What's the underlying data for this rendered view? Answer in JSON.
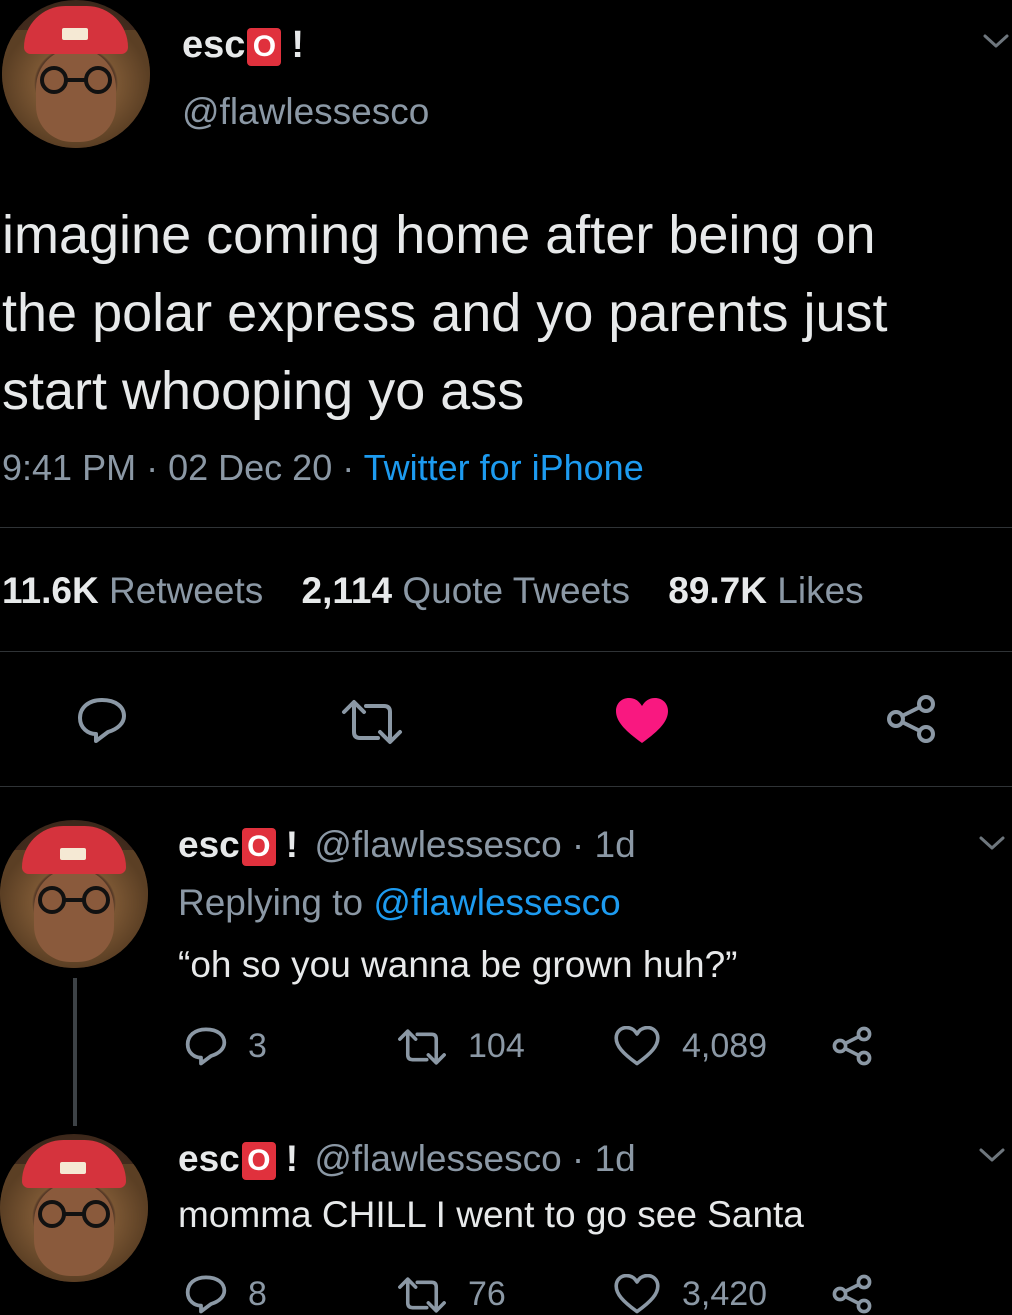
{
  "main_tweet": {
    "display_name_prefix": "esc",
    "display_name_badge": "O",
    "display_name_suffix": "!",
    "handle": "@flawlessesco",
    "text_line1": "imagine coming home after being on",
    "text_line2": "the polar express and yo parents just",
    "text_line3": "start whooping yo ass",
    "time": "9:41 PM",
    "date": "02 Dec 20",
    "source": "Twitter for iPhone",
    "sep": "·",
    "stats": {
      "retweets_num": "11.6K",
      "retweets_label": "Retweets",
      "quotes_num": "2,114",
      "quotes_label": "Quote Tweets",
      "likes_num": "89.7K",
      "likes_label": "Likes"
    }
  },
  "replies": [
    {
      "display_name_prefix": "esc",
      "display_name_badge": "O",
      "display_name_suffix": "!",
      "handle_time": "@flawlessesco · 1d",
      "replying_prefix": "Replying to",
      "replying_handle": "@flawlessesco",
      "text": "“oh so you wanna be grown huh?”",
      "reply_count": "3",
      "retweet_count": "104",
      "like_count": "4,089"
    },
    {
      "display_name_prefix": "esc",
      "display_name_badge": "O",
      "display_name_suffix": "!",
      "handle_time": "@flawlessesco · 1d",
      "text": "momma CHILL I went to go see Santa",
      "reply_count": "8",
      "retweet_count": "76",
      "like_count": "3,420"
    }
  ],
  "colors": {
    "background": "#000000",
    "text": "#e7e9ea",
    "muted": "#8b98a5",
    "link": "#1d9bf0",
    "like_active": "#f91880",
    "badge": "#e0313d"
  },
  "icons": [
    "chevron-down-icon",
    "reply-icon",
    "retweet-icon",
    "heart-icon",
    "share-icon"
  ]
}
